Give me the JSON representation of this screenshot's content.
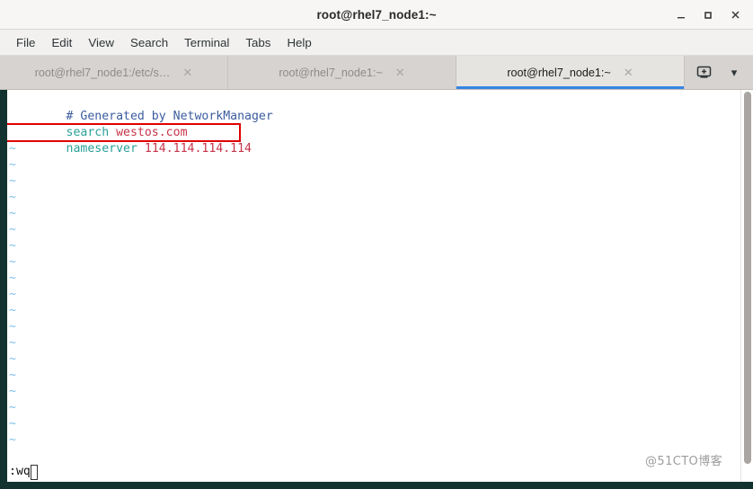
{
  "window": {
    "title": "root@rhel7_node1:~",
    "controls": [
      {
        "name": "minimize",
        "glyph": "—"
      },
      {
        "name": "maximize",
        "glyph": "□"
      },
      {
        "name": "close",
        "glyph": "✕"
      }
    ]
  },
  "menubar": {
    "items": [
      {
        "label": "File"
      },
      {
        "label": "Edit"
      },
      {
        "label": "View"
      },
      {
        "label": "Search"
      },
      {
        "label": "Terminal"
      },
      {
        "label": "Tabs"
      },
      {
        "label": "Help"
      }
    ]
  },
  "tabbar": {
    "tabs": [
      {
        "label": "root@rhel7_node1:/etc/s…",
        "active": false,
        "close_glyph": "✕"
      },
      {
        "label": "root@rhel7_node1:~",
        "active": false,
        "close_glyph": "✕"
      },
      {
        "label": "root@rhel7_node1:~",
        "active": true,
        "close_glyph": "✕"
      }
    ],
    "new_tab_icon": "new-tab-icon",
    "dropdown_icon": "chevron-down-icon",
    "dropdown_glyph": "▾"
  },
  "terminal": {
    "editor": "vim",
    "file_lines": [
      {
        "spans": [
          {
            "text": "# Generated by NetworkManager",
            "class": "c-comment"
          }
        ]
      },
      {
        "spans": [
          {
            "text": "search ",
            "class": "c-keyword"
          },
          {
            "text": "westos.com",
            "class": "c-string"
          }
        ]
      },
      {
        "spans": [
          {
            "text": "nameserver ",
            "class": "c-keyword"
          },
          {
            "text": "114.114.114.114",
            "class": "c-string"
          }
        ]
      }
    ],
    "empty_marker": "~",
    "empty_marker_count": 19,
    "command_line": ":wq",
    "highlight": {
      "name": "nameserver-highlight-box",
      "color": "#e00000",
      "target_text": "nameserver 114.114.114.114"
    },
    "colors": {
      "background": "#ffffff",
      "comment": "#3b5c9e",
      "keyword": "#2aa198",
      "string": "#c7344a",
      "tilde": "#7fc0e8",
      "border": "#12332f"
    }
  },
  "watermark": {
    "text": "@51CTO博客"
  }
}
